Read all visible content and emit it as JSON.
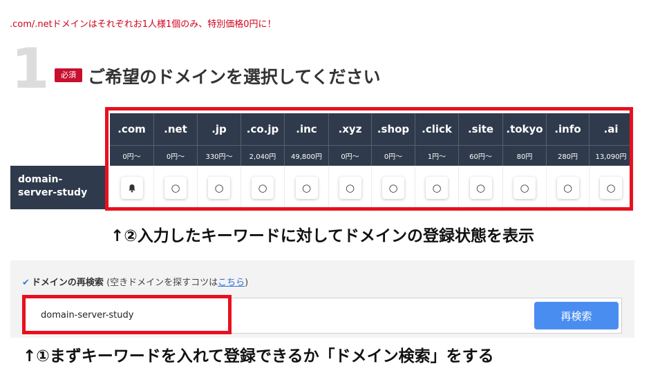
{
  "notice": ".com/.netドメインはそれぞれお1人様1個のみ、特別価格0円に！",
  "step": {
    "number": "1",
    "required_badge": "必須",
    "title": "ご希望のドメインを選択してください"
  },
  "tlds": [
    {
      "name": ".com",
      "price": "0円～",
      "status": "bell"
    },
    {
      "name": ".net",
      "price": "0円～",
      "status": "○"
    },
    {
      "name": ".jp",
      "price": "330円～",
      "status": "○"
    },
    {
      "name": ".co.jp",
      "price": "2,040円",
      "status": "○"
    },
    {
      "name": ".inc",
      "price": "49,800円",
      "status": "○"
    },
    {
      "name": ".xyz",
      "price": "0円～",
      "status": "○"
    },
    {
      "name": ".shop",
      "price": "0円～",
      "status": "○"
    },
    {
      "name": ".click",
      "price": "1円～",
      "status": "○"
    },
    {
      "name": ".site",
      "price": "60円～",
      "status": "○"
    },
    {
      "name": ".tokyo",
      "price": "80円",
      "status": "○"
    },
    {
      "name": ".info",
      "price": "280円",
      "status": "○"
    },
    {
      "name": ".ai",
      "price": "13,090円",
      "status": "○"
    }
  ],
  "row_label": "domain-\nserver-study",
  "annotation1": "↑②入力したキーワードに対してドメインの登録状態を表示",
  "research": {
    "title": "ドメインの再検索",
    "hint_prefix": "(空きドメインを探すコツは",
    "hint_link": "こちら",
    "hint_suffix": ")",
    "input_value": "domain-server-study",
    "button_label": "再検索"
  },
  "annotation2": "↑①まずキーワードを入れて登録できるか「ドメイン検索」をする",
  "colors": {
    "header_bg": "#2f3b4c",
    "highlight": "#e8101e",
    "button": "#4a8df0",
    "badge": "#c8102e"
  }
}
